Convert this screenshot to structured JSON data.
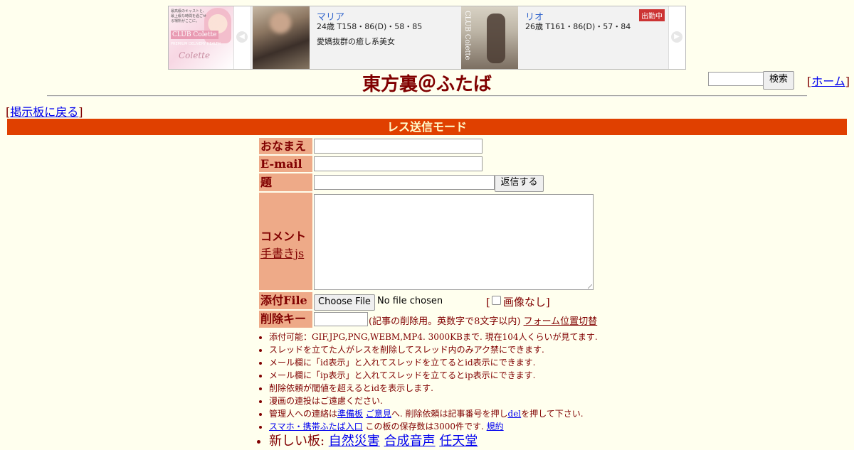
{
  "banner": {
    "logo": {
      "tagline": "最高級のキャストと、最上級な時間を過ごせる場所がここに。",
      "brand": "CLUB Colette",
      "sub": "PREMIUM DELIVERY HEALTH",
      "script": "Colette"
    },
    "cards": [
      {
        "name": "マリア",
        "stats": "24歳 T158・86(D)・58・85",
        "catch": "愛嬌抜群の癒し系美女",
        "badge": "",
        "photo_text": ""
      },
      {
        "name": "リオ",
        "stats": "26歳 T161・86(D)・57・84",
        "catch": "",
        "badge": "出勤中",
        "photo_text": "CLUB Colette"
      }
    ],
    "prev_icon": "◀",
    "next_icon": "▶"
  },
  "header": {
    "title": "東方裏＠ふたば",
    "search_value": "",
    "search_button": "検索",
    "home_link": "ホーム",
    "bracket_open": "[",
    "bracket_close": "]"
  },
  "back_link": "掲示板に戻る",
  "mode_bar": "レス送信モード",
  "form": {
    "name_label": "おなまえ",
    "email_label": "E-mail",
    "subject_label": "題　名",
    "comment_label": "コメント",
    "draw_link": "手書きjs",
    "file_label": "添付File",
    "delkey_label": "削除キー",
    "name_value": "",
    "email_value": "",
    "subject_value": "",
    "submit": "返信する",
    "file_button": "Choose File",
    "file_status": "No file chosen",
    "no_image": "画像なし",
    "delkey_value": "",
    "delkey_note": "(記事の削除用。英数字で8文字以内)",
    "form_toggle": "フォーム位置切替"
  },
  "rules": {
    "r1": "添付可能：GIF,JPG,PNG,WEBM,MP4. 3000KBまで. 現在104人くらいが見てます.",
    "r2": "スレッドを立てた人がレスを削除してスレッド内のみアク禁にできます.",
    "r3": "メール欄に「id表示」と入れてスレッドを立てるとid表示にできます.",
    "r4": "メール欄に「ip表示」と入れてスレッドを立てるとip表示にできます.",
    "r5": "削除依頼が閾値を超えるとidを表示します.",
    "r6": "漫画の連投はご遠慮ください.",
    "r7": {
      "pre": "管理人への連絡は",
      "link1": "準備板",
      "link2": "ご意見",
      "mid": "へ. 削除依頼は記事番号を押し",
      "link3": "del",
      "post": "を押して下さい."
    },
    "r8": {
      "link1": "スマホ・携帯ふたば入口",
      "mid": " この板の保存数は3000件です. ",
      "link2": "規約"
    },
    "r9": {
      "pre": "新しい板: ",
      "boards": [
        "自然災害",
        "合成音声",
        "任天堂"
      ]
    }
  },
  "colors": {
    "background": "#ffffee",
    "text": "#800000",
    "mode_bar": "#e04000",
    "label_bg": "#eeaa88",
    "link": "#0000ee"
  }
}
